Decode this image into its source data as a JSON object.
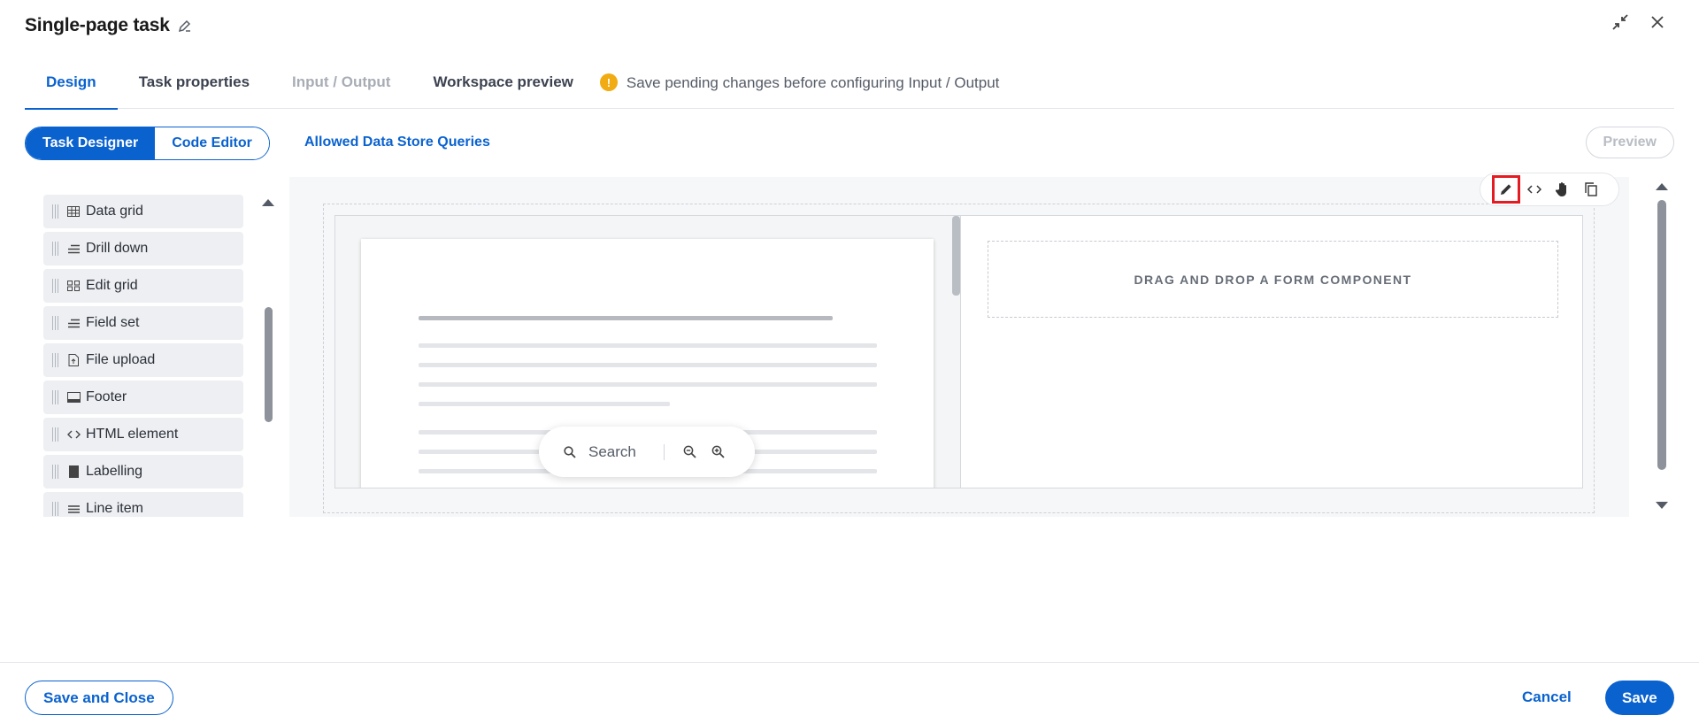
{
  "header": {
    "title": "Single-page task"
  },
  "tabs": [
    {
      "label": "Design",
      "state": "active"
    },
    {
      "label": "Task properties",
      "state": "normal"
    },
    {
      "label": "Input / Output",
      "state": "disabled"
    },
    {
      "label": "Workspace preview",
      "state": "normal"
    }
  ],
  "notice": {
    "icon": "warning-icon",
    "text": "Save pending changes before configuring Input / Output"
  },
  "toolbar": {
    "segments": [
      {
        "label": "Task Designer",
        "active": true
      },
      {
        "label": "Code Editor",
        "active": false
      }
    ],
    "queries_link": "Allowed Data Store Queries",
    "preview_label": "Preview"
  },
  "palette": {
    "items": [
      {
        "label": "Data grid",
        "icon": "grid-icon"
      },
      {
        "label": "Drill down",
        "icon": "lines-icon"
      },
      {
        "label": "Edit grid",
        "icon": "edit-grid-icon"
      },
      {
        "label": "Field set",
        "icon": "lines-icon"
      },
      {
        "label": "File upload",
        "icon": "file-upload-icon"
      },
      {
        "label": "Footer",
        "icon": "footer-icon"
      },
      {
        "label": "HTML element",
        "icon": "code-icon"
      },
      {
        "label": "Labelling",
        "icon": "label-block-icon"
      },
      {
        "label": "Line item",
        "icon": "list-icon"
      }
    ]
  },
  "canvas": {
    "tools": [
      "pencil-icon",
      "code-icon",
      "hand-icon",
      "copy-icon"
    ],
    "dropzone_text": "DRAG AND DROP A FORM COMPONENT",
    "doc_viewer": {
      "search_label": "Search",
      "zoom_out": "zoom-out-icon",
      "zoom_in": "zoom-in-icon"
    }
  },
  "footer": {
    "save_close": "Save and Close",
    "cancel": "Cancel",
    "save": "Save"
  },
  "colors": {
    "accent": "#0a62cf",
    "warning": "#f1ab13",
    "highlight": "#e31b23"
  }
}
